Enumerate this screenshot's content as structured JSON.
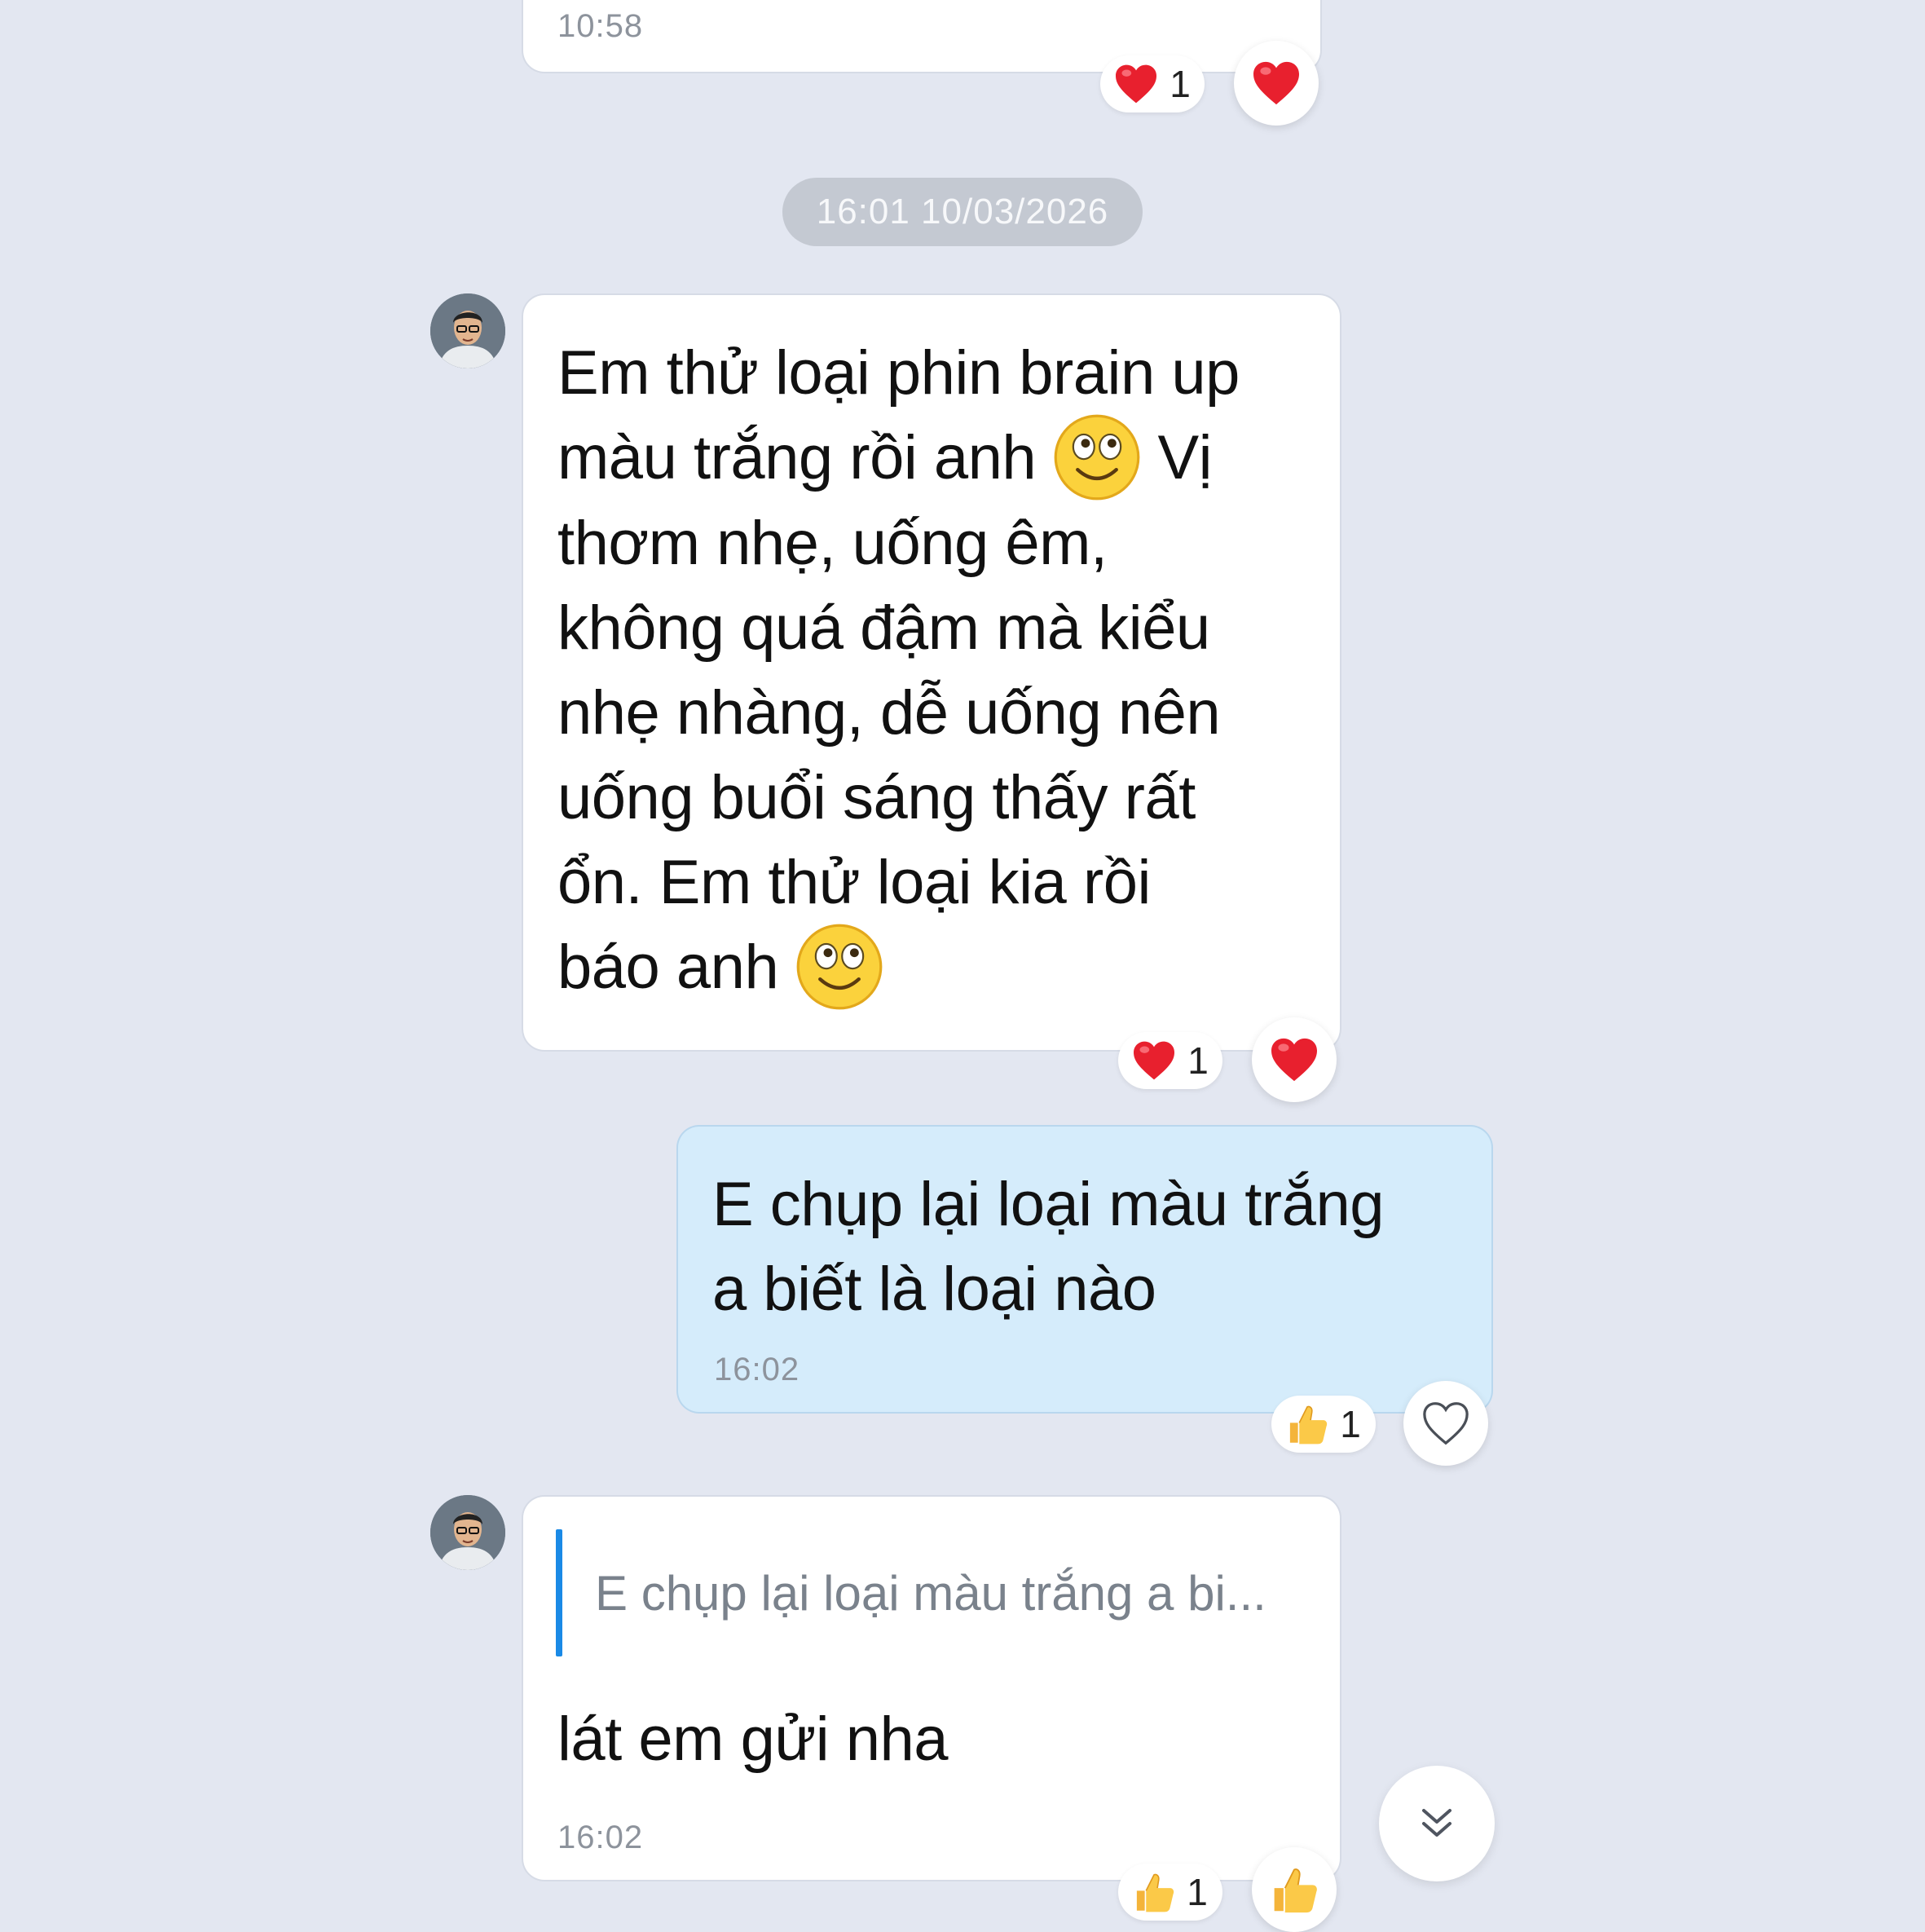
{
  "messages": {
    "prev": {
      "time": "10:58",
      "reaction_count": "1"
    },
    "date_separator": "16:01 10/03/2026",
    "m1": {
      "lines": [
        "Em thử loại phin brain up",
        "màu trắng rồi anh",
        "Vị",
        "thơm nhẹ, uống êm,",
        "không quá đậm mà kiểu",
        "nhẹ nhàng, dễ uống nên",
        "uống buổi sáng thấy rất",
        "ổn. Em thử loại kia rồi",
        "báo anh"
      ],
      "reaction_count": "1"
    },
    "m2": {
      "lines": [
        "E chụp lại loại màu trắng",
        "a biết là loại nào"
      ],
      "time": "16:02",
      "reaction_count": "1"
    },
    "m3": {
      "quote": "E chụp lại loại màu trắng a bi...",
      "text": "lát em gửi nha",
      "time": "16:02",
      "reaction_count": "1"
    }
  },
  "icons": {
    "heart": "heart-icon",
    "heart_outline": "heart-outline-icon",
    "thumbs_up": "thumbs-up-icon",
    "smiley": "smiley-emoji-icon",
    "scroll_down": "double-chevron-down-icon"
  },
  "colors": {
    "background": "#e3e7f1",
    "incoming_bubble": "#ffffff",
    "outgoing_bubble": "#d5ecfb",
    "quote_bar": "#1a8ae6",
    "heart": "#e8202e"
  }
}
